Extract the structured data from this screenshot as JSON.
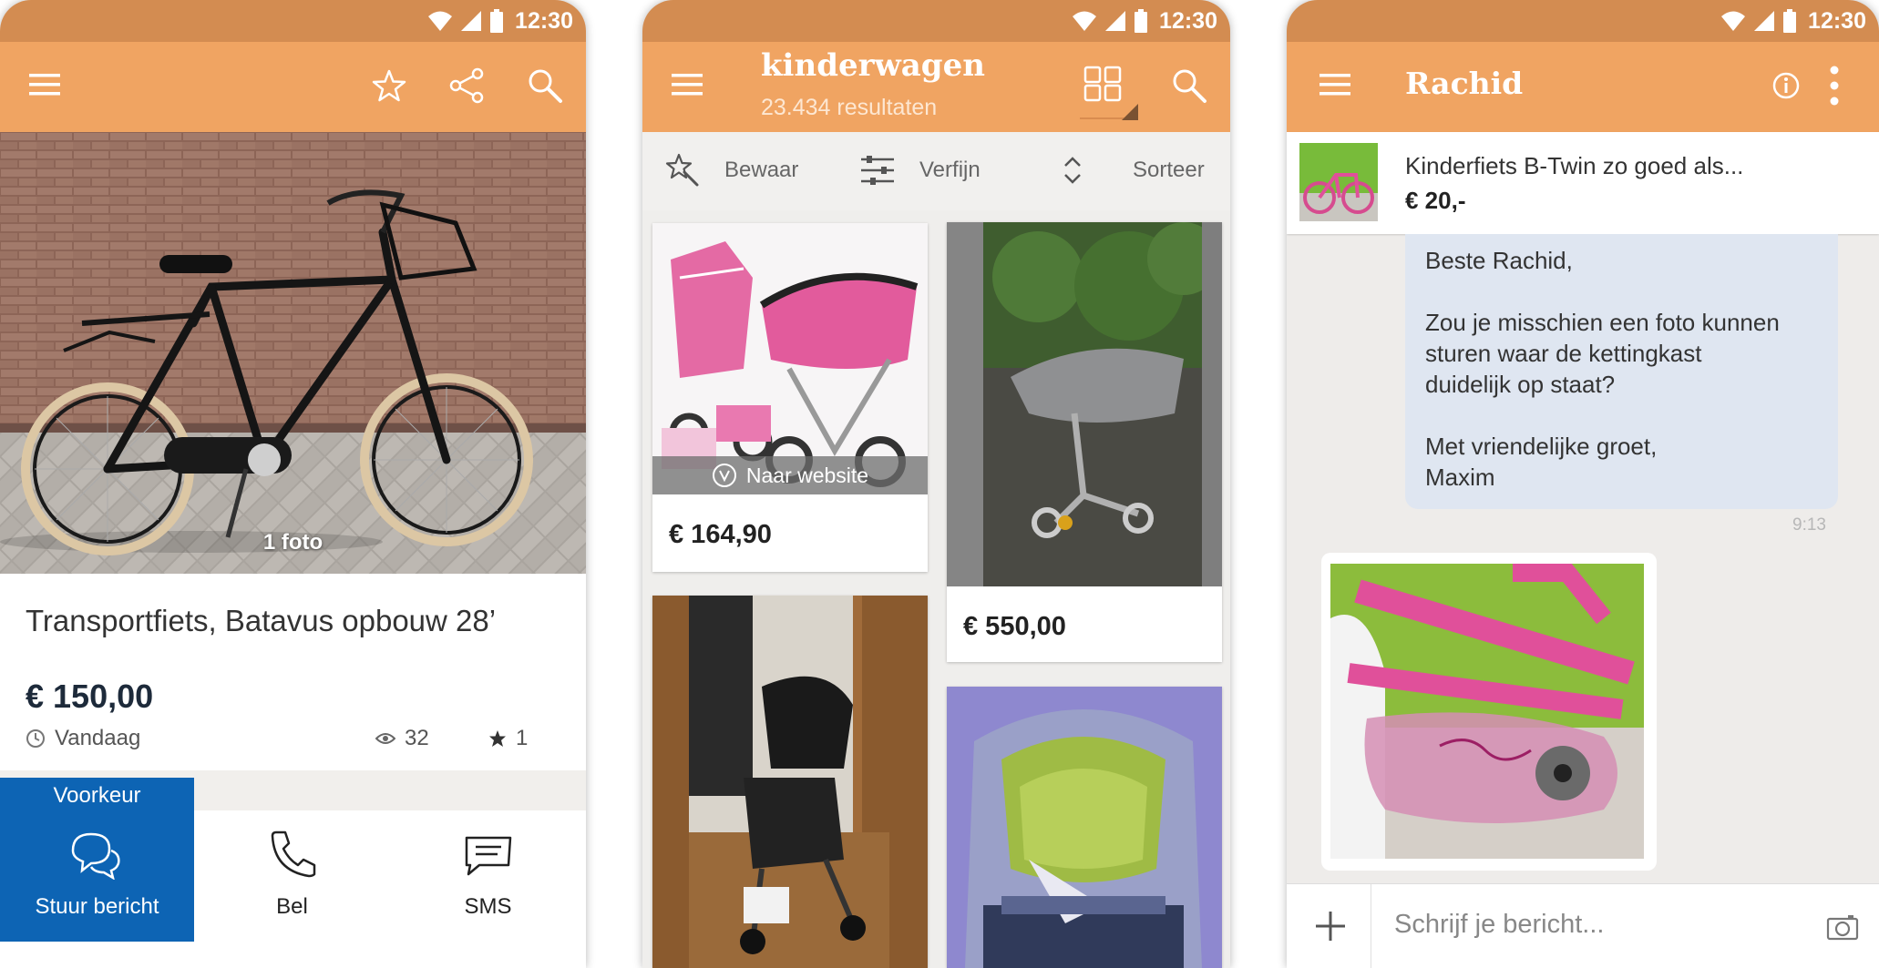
{
  "status_bar": {
    "time": "12:30"
  },
  "screen1": {
    "photo_count": "1 foto",
    "title": "Transportfiets, Batavus opbouw 28’",
    "price": "€ 150,00",
    "date": "Vandaag",
    "views": "32",
    "favorites": "1",
    "contact": {
      "preference": "Voorkeur",
      "message": "Stuur bericht",
      "call": "Bel",
      "sms": "SMS"
    },
    "icons": [
      "menu-icon",
      "star-icon",
      "share-icon",
      "search-icon",
      "clock-icon",
      "eye-icon",
      "chat-bubbles-icon",
      "phone-icon",
      "sms-icon"
    ],
    "colors": {
      "statusbar": "#d38c51",
      "appbar": "#f0a462",
      "primary_button": "#0d64b4"
    }
  },
  "screen2": {
    "query": "kinderwagen",
    "results": "23.434 resultaten",
    "toolbar": {
      "save": "Bewaar",
      "refine": "Verfijn",
      "sort": "Sorteer"
    },
    "listings": [
      {
        "price": "€ 164,90",
        "badge": "Naar website"
      },
      {
        "price": "€ 550,00"
      },
      {
        "price": ""
      },
      {
        "price": ""
      }
    ],
    "icons": [
      "menu-icon",
      "grid-view-icon",
      "search-icon",
      "save-search-icon",
      "filter-icon",
      "sort-icon",
      "external-link-icon"
    ]
  },
  "screen3": {
    "contact_name": "Rachid",
    "item": {
      "title": "Kinderfiets B-Twin zo goed als...",
      "price": "€ 20,-"
    },
    "message_lines": [
      "Beste Rachid,",
      "Zou je misschien een foto kunnen",
      "sturen waar de kettingkast",
      "duidelijk op staat?",
      "Met vriendelijke groet,",
      "Maxim"
    ],
    "message_time": "9:13",
    "composer_placeholder": "Schrijf je bericht...",
    "icons": [
      "menu-icon",
      "info-icon",
      "more-vert-icon",
      "plus-icon",
      "camera-icon"
    ]
  }
}
